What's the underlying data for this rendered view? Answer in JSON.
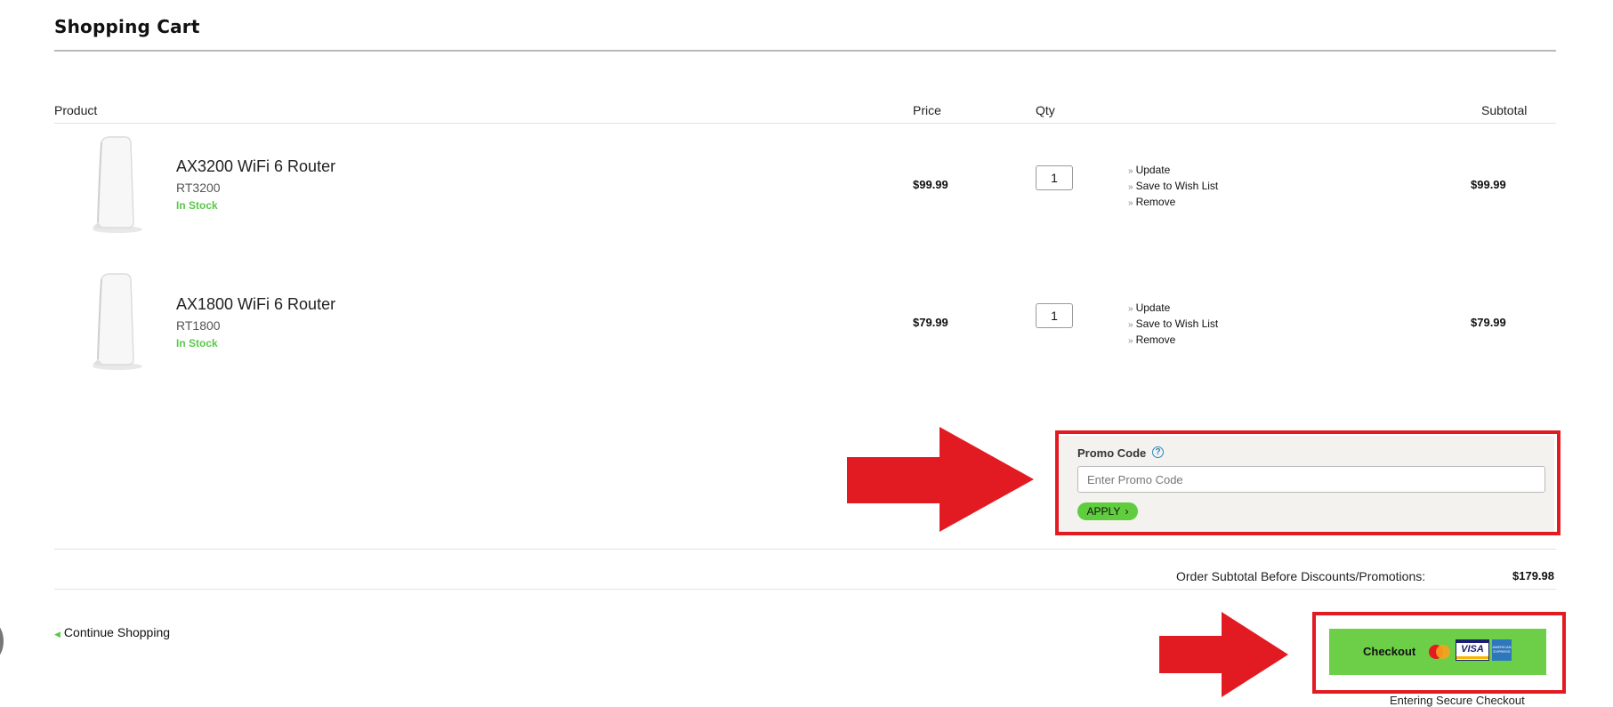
{
  "cart": {
    "title": "Shopping Cart",
    "columns": {
      "product": "Product",
      "price": "Price",
      "qty": "Qty",
      "subtotal": "Subtotal"
    },
    "items": [
      {
        "name": "AX3200 WiFi 6 Router",
        "sku": "RT3200",
        "stock": "In Stock",
        "price": "$99.99",
        "qty": "1",
        "actions": [
          "Update",
          "Save to Wish List",
          "Remove"
        ],
        "subtotal": "$99.99"
      },
      {
        "name": "AX1800 WiFi 6 Router",
        "sku": "RT1800",
        "stock": "In Stock",
        "price": "$79.99",
        "qty": "1",
        "actions": [
          "Update",
          "Save to Wish List",
          "Remove"
        ],
        "subtotal": "$79.99"
      }
    ]
  },
  "promo": {
    "label": "Promo Code",
    "help_icon": "?",
    "placeholder": "Enter Promo Code",
    "apply_label": "APPLY"
  },
  "summary": {
    "label": "Order Subtotal Before Discounts/Promotions:",
    "value": "$179.98"
  },
  "continue_shopping": "Continue Shopping",
  "checkout": {
    "label": "Checkout",
    "cards": [
      "mastercard-icon",
      "visa-icon",
      "amex-icon"
    ],
    "visa_text": "VISA",
    "amex_text": "AMERICAN EXPRESS",
    "secure_text": "Entering Secure Checkout"
  },
  "colors": {
    "highlight": "#e21b23",
    "accent_green": "#6dcf48",
    "stock_green": "#5ac84a",
    "promo_bg": "#f3f2ef"
  }
}
